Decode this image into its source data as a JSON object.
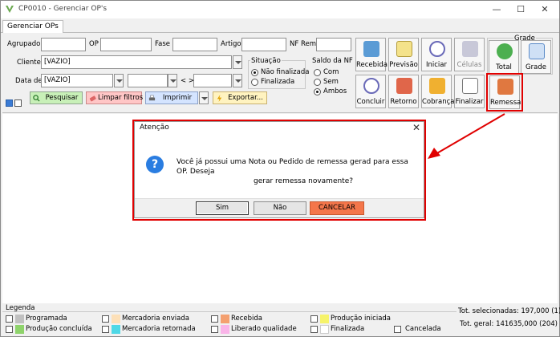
{
  "window": {
    "title": "CP0010 - Gerenciar OP's",
    "tab": "Gerenciar OPs"
  },
  "filters": {
    "agrupador_label": "Agrupador",
    "op_label": "OP",
    "fase_label": "Fase",
    "artigo_label": "Artigo",
    "nf_rem_label": "NF Rem.",
    "cliente_label": "Cliente",
    "cliente_value": "[VAZIO]",
    "data_label": "Data de",
    "data_value": "[VAZIO]",
    "between_label": "< >",
    "situacao_label": "Situação",
    "situacao_options": [
      "Não finalizada",
      "Finalizada"
    ],
    "saldo_label": "Saldo da NF",
    "saldo_options": [
      "Com",
      "Sem",
      "Ambos"
    ]
  },
  "actions": {
    "pesquisar": "Pesquisar",
    "limpar": "Limpar filtros",
    "imprimir": "Imprimir",
    "exportar": "Exportar..."
  },
  "toolbar": {
    "recebida": "Recebida",
    "previsao": "Previsão",
    "iniciar": "Iniciar",
    "celulas": "Células",
    "concluir": "Concluir",
    "retorno": "Retorno",
    "cobranca": "Cobrança",
    "finalizar": "Finalizar",
    "remessa": "Remessa",
    "grade_group": "Grade",
    "total": "Total",
    "grade": "Grade"
  },
  "dialog": {
    "title": "Atenção",
    "message_line1": "Você já possui uma Nota ou Pedido de remessa gerad para essa OP. Deseja",
    "message_line2": "gerar remessa novamente?",
    "yes": "Sim",
    "no": "Não",
    "cancel": "CANCELAR"
  },
  "legend": {
    "title": "Legenda",
    "items": [
      {
        "label": "Programada",
        "color": "#c0c0c0"
      },
      {
        "label": "Mercadoria enviada",
        "color": "#fde0b8"
      },
      {
        "label": "Recebida",
        "color": "#f4a070"
      },
      {
        "label": "Produção iniciada",
        "color": "#f6f36a"
      },
      {
        "label": "Produção concluída",
        "color": "#8ed36b"
      },
      {
        "label": "Mercadoria retornada",
        "color": "#4fd8e6"
      },
      {
        "label": "Liberado qualidade",
        "color": "#f9b4e8"
      },
      {
        "label": "Finalizada",
        "color": "#ffffff"
      },
      {
        "label": "Cancelada",
        "color": "#ffffff"
      }
    ]
  },
  "totals": {
    "selected": "Tot. selecionadas: 197,000 (1)",
    "general": "Tot. geral: 141635,000 (204)"
  }
}
